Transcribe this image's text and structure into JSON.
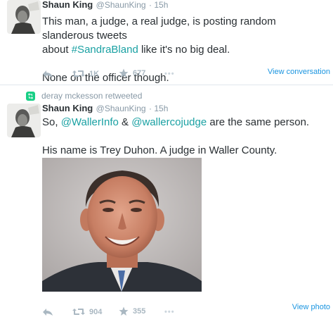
{
  "tweet1": {
    "name": "Shaun King",
    "handle": "@ShaunKing",
    "time": "· 15h",
    "text_line1": "This man, a judge, a real judge, is posting random slanderous tweets",
    "text_line2_pre": "about ",
    "hashtag": "#SandraBland",
    "text_line2_post": " like it's no big deal.",
    "text_line3": "None on the officer though.",
    "retweets": "1K",
    "likes": "677",
    "more": "•••",
    "view_link": "View conversation"
  },
  "retweet_context": {
    "label": "deray mckesson retweeted"
  },
  "tweet2": {
    "name": "Shaun King",
    "handle": "@ShaunKing",
    "time": "· 15h",
    "text_pre": "So, ",
    "mention1": "@WallerInfo",
    "text_mid": " & ",
    "mention2": "@wallercojudge",
    "text_post": " are the same person.",
    "text_line2": "His name is Trey Duhon. A judge in Waller County.",
    "retweets": "904",
    "likes": "355",
    "more": "•••",
    "view_link": "View photo"
  },
  "icons": {
    "reply": "reply-icon",
    "retweet": "retweet-icon",
    "like": "star-icon",
    "more": "more-icon",
    "retweet_context": "retweet-context-icon"
  },
  "colors": {
    "link": "#1aa1a3",
    "action_gray": "#aab8c2",
    "view_link": "#1b95e0",
    "retweet_green": "#19cf86"
  }
}
